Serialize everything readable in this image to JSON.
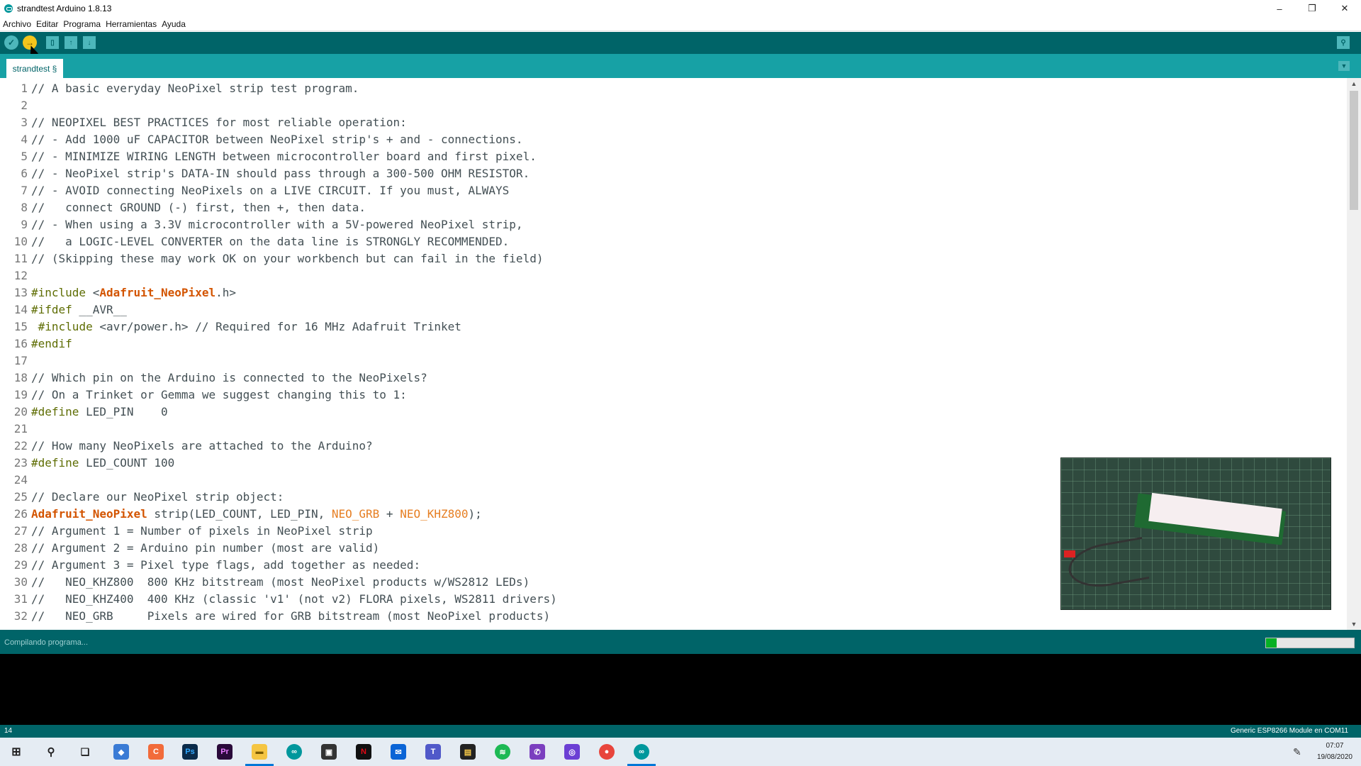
{
  "window": {
    "title": "strandtest Arduino 1.8.13",
    "controls": {
      "minimize": "–",
      "restore": "❐",
      "close": "✕"
    }
  },
  "menu": [
    "Archivo",
    "Editar",
    "Programa",
    "Herramientas",
    "Ayuda"
  ],
  "toolbar": {
    "verify_icon": "check-icon",
    "upload_icon": "arrow-right-icon",
    "new_icon": "new-file-icon",
    "open_icon": "open-up-arrow-icon",
    "save_icon": "save-down-arrow-icon",
    "serial_icon": "magnifier-icon"
  },
  "tab": {
    "label": "strandtest §"
  },
  "code_lines": [
    "// A basic everyday NeoPixel strip test program.",
    "",
    "// NEOPIXEL BEST PRACTICES for most reliable operation:",
    "// - Add 1000 uF CAPACITOR between NeoPixel strip's + and - connections.",
    "// - MINIMIZE WIRING LENGTH between microcontroller board and first pixel.",
    "// - NeoPixel strip's DATA-IN should pass through a 300-500 OHM RESISTOR.",
    "// - AVOID connecting NeoPixels on a LIVE CIRCUIT. If you must, ALWAYS",
    "//   connect GROUND (-) first, then +, then data.",
    "// - When using a 3.3V microcontroller with a 5V-powered NeoPixel strip,",
    "//   a LOGIC-LEVEL CONVERTER on the data line is STRONGLY RECOMMENDED.",
    "// (Skipping these may work OK on your workbench but can fail in the field)",
    "",
    "#include <Adafruit_NeoPixel.h>",
    "#ifdef __AVR__",
    " #include <avr/power.h> // Required for 16 MHz Adafruit Trinket",
    "#endif",
    "",
    "// Which pin on the Arduino is connected to the NeoPixels?",
    "// On a Trinket or Gemma we suggest changing this to 1:",
    "#define LED_PIN    0",
    "",
    "// How many NeoPixels are attached to the Arduino?",
    "#define LED_COUNT 100",
    "",
    "// Declare our NeoPixel strip object:",
    "Adafruit_NeoPixel strip(LED_COUNT, LED_PIN, NEO_GRB + NEO_KHZ800);",
    "// Argument 1 = Number of pixels in NeoPixel strip",
    "// Argument 2 = Arduino pin number (most are valid)",
    "// Argument 3 = Pixel type flags, add together as needed:",
    "//   NEO_KHZ800  800 KHz bitstream (most NeoPixel products w/WS2812 LEDs)",
    "//   NEO_KHZ400  400 KHz (classic 'v1' (not v2) FLORA pixels, WS2811 drivers)",
    "//   NEO_GRB     Pixels are wired for GRB bitstream (most NeoPixel products)"
  ],
  "status": {
    "message": "Compilando programa...",
    "progress": 0.12
  },
  "infobar": {
    "line": "14",
    "board": "Generic ESP8266 Module en COM11"
  },
  "taskbar": {
    "time": "07:07",
    "date": "19/08/2020"
  },
  "colors": {
    "toolbar": "#006468",
    "tabs": "#17a1a5",
    "upload": "#f4c51c",
    "keyword_type": "#d35400",
    "preprocessor": "#5e6d03"
  }
}
